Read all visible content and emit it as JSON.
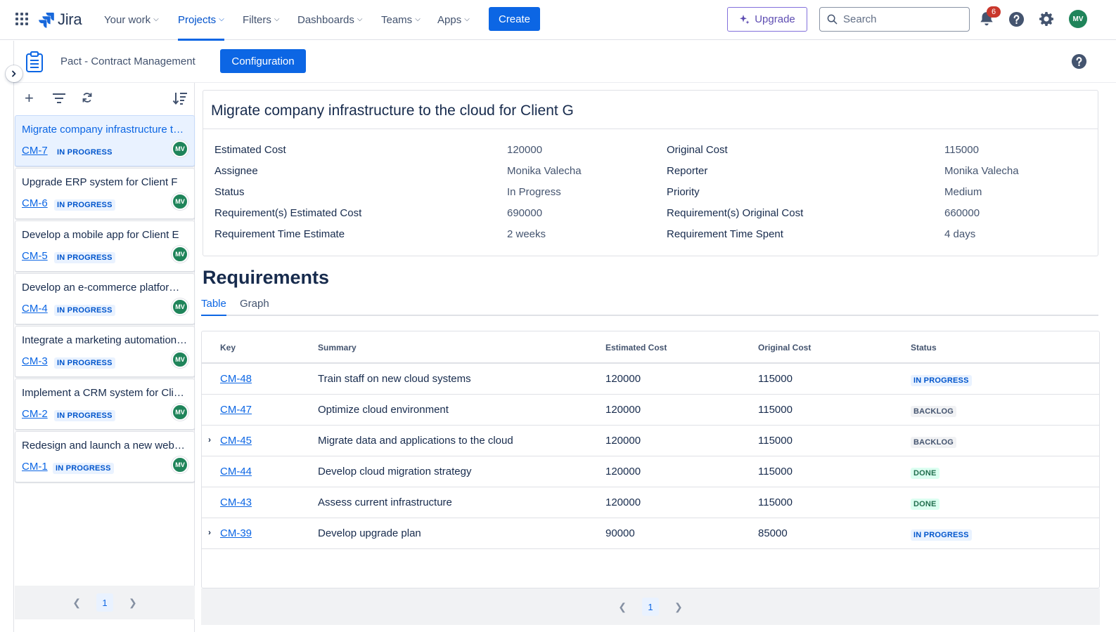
{
  "topnav": {
    "logo_text": "Jira",
    "items": [
      {
        "label": "Your work",
        "active": false
      },
      {
        "label": "Projects",
        "active": true
      },
      {
        "label": "Filters",
        "active": false
      },
      {
        "label": "Dashboards",
        "active": false
      },
      {
        "label": "Teams",
        "active": false
      },
      {
        "label": "Apps",
        "active": false
      }
    ],
    "create_label": "Create",
    "upgrade_label": "Upgrade",
    "search_placeholder": "Search",
    "notification_count": "6",
    "user_initials": "MV"
  },
  "project": {
    "name": "Pact - Contract Management",
    "config_label": "Configuration"
  },
  "issue_list": {
    "items": [
      {
        "title": "Migrate company infrastructure to the cloud for Client G",
        "key": "CM-7",
        "status": "IN PROGRESS",
        "initials": "MV",
        "selected": true
      },
      {
        "title": "Upgrade ERP system for Client F",
        "key": "CM-6",
        "status": "IN PROGRESS",
        "initials": "MV",
        "selected": false
      },
      {
        "title": "Develop a mobile app for Client E",
        "key": "CM-5",
        "status": "IN PROGRESS",
        "initials": "MV",
        "selected": false
      },
      {
        "title": "Develop an e-commerce platform for Client D",
        "key": "CM-4",
        "status": "IN PROGRESS",
        "initials": "MV",
        "selected": false
      },
      {
        "title": "Integrate a marketing automation platform for Client C",
        "key": "CM-3",
        "status": "IN PROGRESS",
        "initials": "MV",
        "selected": false
      },
      {
        "title": "Implement a CRM system for Client B",
        "key": "CM-2",
        "status": "IN PROGRESS",
        "initials": "MV",
        "selected": false
      },
      {
        "title": "Redesign and launch a new website for Client A",
        "key": "CM-1",
        "status": "IN PROGRESS",
        "initials": "MV",
        "selected": false
      }
    ],
    "page": "1"
  },
  "detail": {
    "title": "Migrate company infrastructure to the cloud for Client G",
    "left_fields": [
      {
        "label": "Estimated Cost",
        "value": "120000"
      },
      {
        "label": "Assignee",
        "value": "Monika Valecha"
      },
      {
        "label": "Status",
        "value": "In Progress"
      },
      {
        "label": "Requirement(s) Estimated Cost",
        "value": "690000"
      },
      {
        "label": "Requirement Time Estimate",
        "value": "2 weeks"
      }
    ],
    "right_fields": [
      {
        "label": "Original Cost",
        "value": "115000"
      },
      {
        "label": "Reporter",
        "value": "Monika Valecha"
      },
      {
        "label": "Priority",
        "value": "Medium"
      },
      {
        "label": "Requirement(s) Original Cost",
        "value": "660000"
      },
      {
        "label": "Requirement Time Spent",
        "value": "4 days"
      }
    ]
  },
  "requirements": {
    "heading": "Requirements",
    "tabs": [
      {
        "label": "Table",
        "active": true
      },
      {
        "label": "Graph",
        "active": false
      }
    ],
    "columns": [
      "Key",
      "Summary",
      "Estimated Cost",
      "Original Cost",
      "Status"
    ],
    "rows": [
      {
        "key": "CM-48",
        "summary": "Train staff on new cloud systems",
        "estimated": "120000",
        "original": "115000",
        "status": "IN PROGRESS",
        "expandable": false
      },
      {
        "key": "CM-47",
        "summary": "Optimize cloud environment",
        "estimated": "120000",
        "original": "115000",
        "status": "BACKLOG",
        "expandable": false
      },
      {
        "key": "CM-45",
        "summary": "Migrate data and applications to the cloud",
        "estimated": "120000",
        "original": "115000",
        "status": "BACKLOG",
        "expandable": true
      },
      {
        "key": "CM-44",
        "summary": "Develop cloud migration strategy",
        "estimated": "120000",
        "original": "115000",
        "status": "DONE",
        "expandable": false
      },
      {
        "key": "CM-43",
        "summary": "Assess current infrastructure",
        "estimated": "120000",
        "original": "115000",
        "status": "DONE",
        "expandable": false
      },
      {
        "key": "CM-39",
        "summary": "Develop upgrade plan",
        "estimated": "90000",
        "original": "85000",
        "status": "IN PROGRESS",
        "expandable": true
      }
    ],
    "page": "1"
  },
  "icons": {
    "apps": "apps-grid-icon",
    "notifications": "bell-icon",
    "help": "question-icon",
    "settings": "gear-icon",
    "search": "search-icon"
  },
  "colors": {
    "primary": "#0C66E4",
    "in_progress": "#0055CC",
    "done": "#216E4E",
    "backlog": "#44546F",
    "avatar": "#1F845A"
  }
}
